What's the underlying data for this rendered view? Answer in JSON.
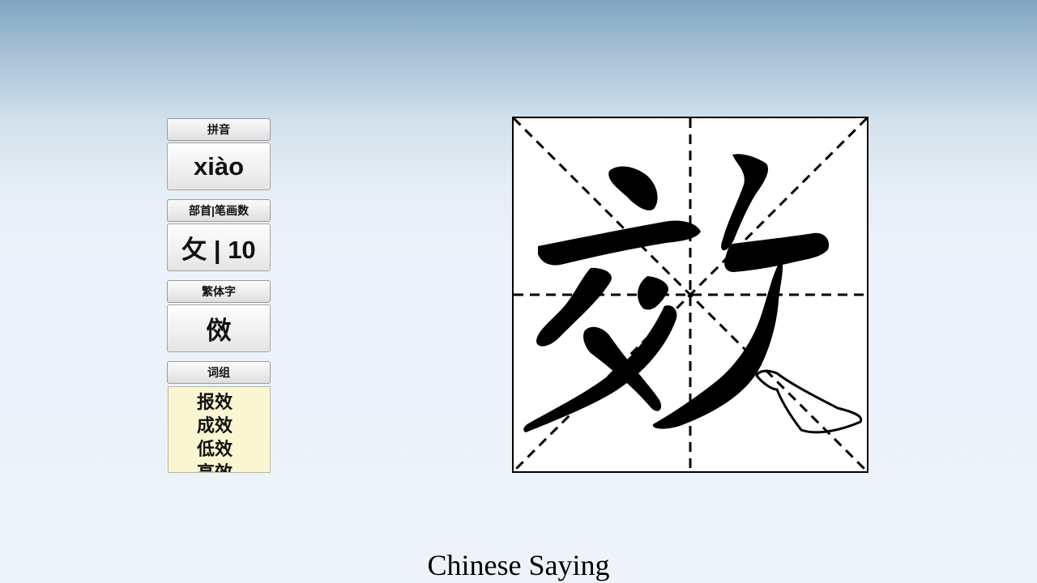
{
  "panel": {
    "pinyin_label": "拼音",
    "pinyin_value": "xiào",
    "radical_strokes_label": "部首|笔画数",
    "radical_strokes_value": "攵 | 10",
    "traditional_label": "繁体字",
    "traditional_value": "傚",
    "words_label": "词组",
    "words": [
      "报效",
      "成效",
      "低效",
      "高效"
    ]
  },
  "character_display": {
    "character": "效",
    "grid": "米字格"
  },
  "caption": "Chinese Saying"
}
